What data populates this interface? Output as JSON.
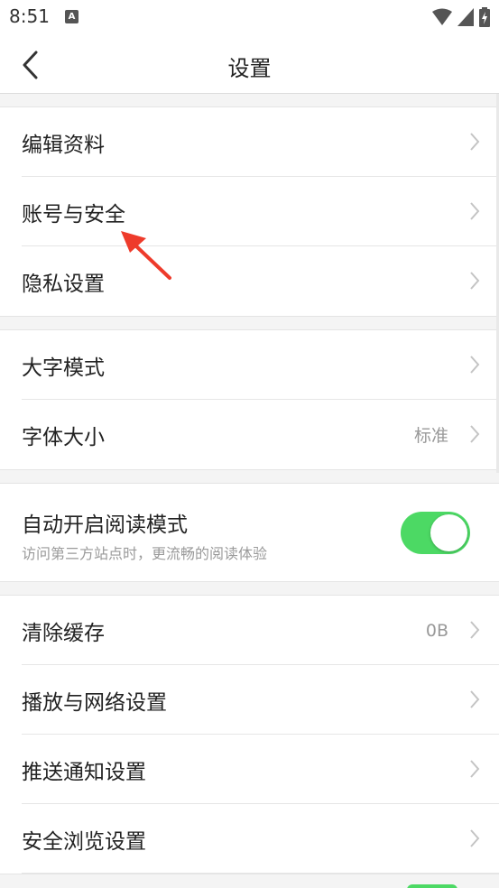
{
  "status_bar": {
    "time": "8:51",
    "notif_letter": "A"
  },
  "header": {
    "title": "设置"
  },
  "section1": [
    {
      "label": "编辑资料"
    },
    {
      "label": "账号与安全"
    },
    {
      "label": "隐私设置"
    }
  ],
  "section2": [
    {
      "label": "大字模式",
      "value": ""
    },
    {
      "label": "字体大小",
      "value": "标准"
    }
  ],
  "reading_mode": {
    "title": "自动开启阅读模式",
    "subtitle": "访问第三方站点时，更流畅的阅读体验",
    "enabled": true
  },
  "section3": [
    {
      "label": "清除缓存",
      "value": "0B"
    },
    {
      "label": "播放与网络设置",
      "value": ""
    },
    {
      "label": "推送通知设置",
      "value": ""
    },
    {
      "label": "安全浏览设置",
      "value": ""
    }
  ],
  "colors": {
    "toggle_on": "#4cd964",
    "annotation_arrow": "#ee3b2b"
  }
}
